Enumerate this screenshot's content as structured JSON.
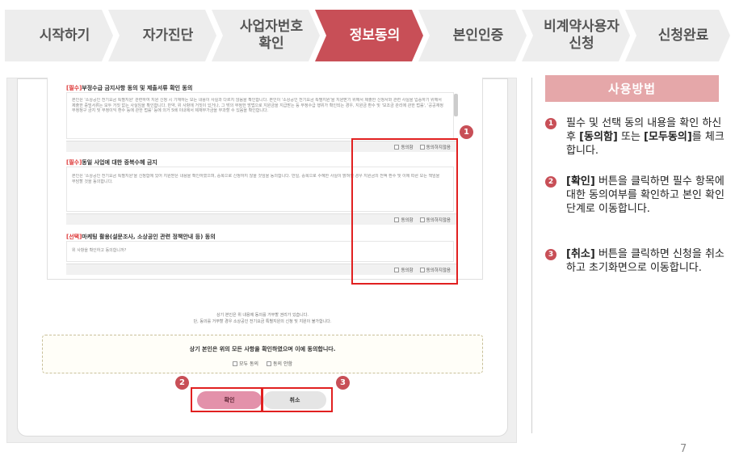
{
  "steps": [
    "시작하기",
    "자가진단",
    "사업자번호\n확인",
    "정보동의",
    "본인인증",
    "비계약사용자\n신청",
    "신청완료"
  ],
  "active_step": 3,
  "colors": {
    "accent": "#c84f57",
    "step_inactive": "#ededed",
    "howto_bg": "#e5a7a9",
    "highlight": "#e12020"
  },
  "screenshot": {
    "sections": [
      {
        "tag": "[필수]",
        "title": "부정수급 금지사항 동의 및 제출서류 확인 동의",
        "body": "본인은 '소상공인 전기요금 특별지원' 관련하여 지원 신청 시 기재하는 모든 내용이 사실과 다르지 않음을 확인합니다. 본인이 '소상공인 전기요금 특별지원'을 지원받기 위해서 제출한 신청서와 관련 사실을 입증하기 위해서 제출한 증빙서류는 모두 거짓 없는 사실임을 확인합니다. 만약, 위 사항에 거짓이 있거나, 그 밖의 부정한 방법으로 지원금을 지급받는 등 부정수급 행위가 확인되는 경우, 지원금 환수 및 '보조금 관리에 관한 법률', '공공재정 부정청구 금지 및 부정이익 환수 등에 관한 법률' 등에 의거 5배 이내에서 제재부가금을 부과할 수 있음을 확인합니다."
      },
      {
        "tag": "[필수]",
        "title": "동일 사업에 대한 중복수혜 금지",
        "body": "본인은 '소상공인 전기요금 특별지원'을 신청함에 있어 지원받은 내용을 확인하였으며, 중복으로 신청하지 않을 것임을 동의합니다. 만일, 중복으로 수혜한 사실이 밝혀질 경우 지원금의 전액 환수 및 이에 따른 모든 책임을 부담할 것을 동의합니다."
      },
      {
        "tag": "[선택]",
        "title": "마케팅 활용(설문조사, 소상공인 관련 정책안내 등) 동의",
        "body": "위 사항을 확인하고 동의합니까?"
      }
    ],
    "agree_label": "동의함",
    "disagree_label": "동의하지않음",
    "notice_line1": "상기 본인은 위 내용에 동의를 거부할 권리가 있습니다.",
    "notice_line2": "단, 동의를 거부할 경우 소상공인 전기요금 특별지원의 신청 및 지원이 불가합니다.",
    "all_title": "상기 본인은 위의 모든 사항을 확인하였으며 이에 동의합니다.",
    "all_agree_label": "모두 동의",
    "all_disagree_label": "동의 안함",
    "confirm_label": "확인",
    "cancel_label": "취소",
    "badges": [
      "1",
      "2",
      "3"
    ]
  },
  "howto": {
    "title": "사용방법",
    "items": [
      {
        "num": "1",
        "pre": "필수 및 선택 동의 내용을 확인 하신 후 ",
        "b1": "[동의함]",
        "mid": " 또는 ",
        "b2": "[모두동의]",
        "post": "를 체크합니다."
      },
      {
        "num": "2",
        "b1": "[확인]",
        "post": " 버튼을 클릭하면 필수 항목에 대한 동의여부를 확인하고 본인 확인 단계로 이동합니다."
      },
      {
        "num": "3",
        "b1": "[취소]",
        "post": " 버튼을 클릭하면 신청을 취소하고 초기화면으로 이동합니다."
      }
    ]
  },
  "page_number": "7"
}
